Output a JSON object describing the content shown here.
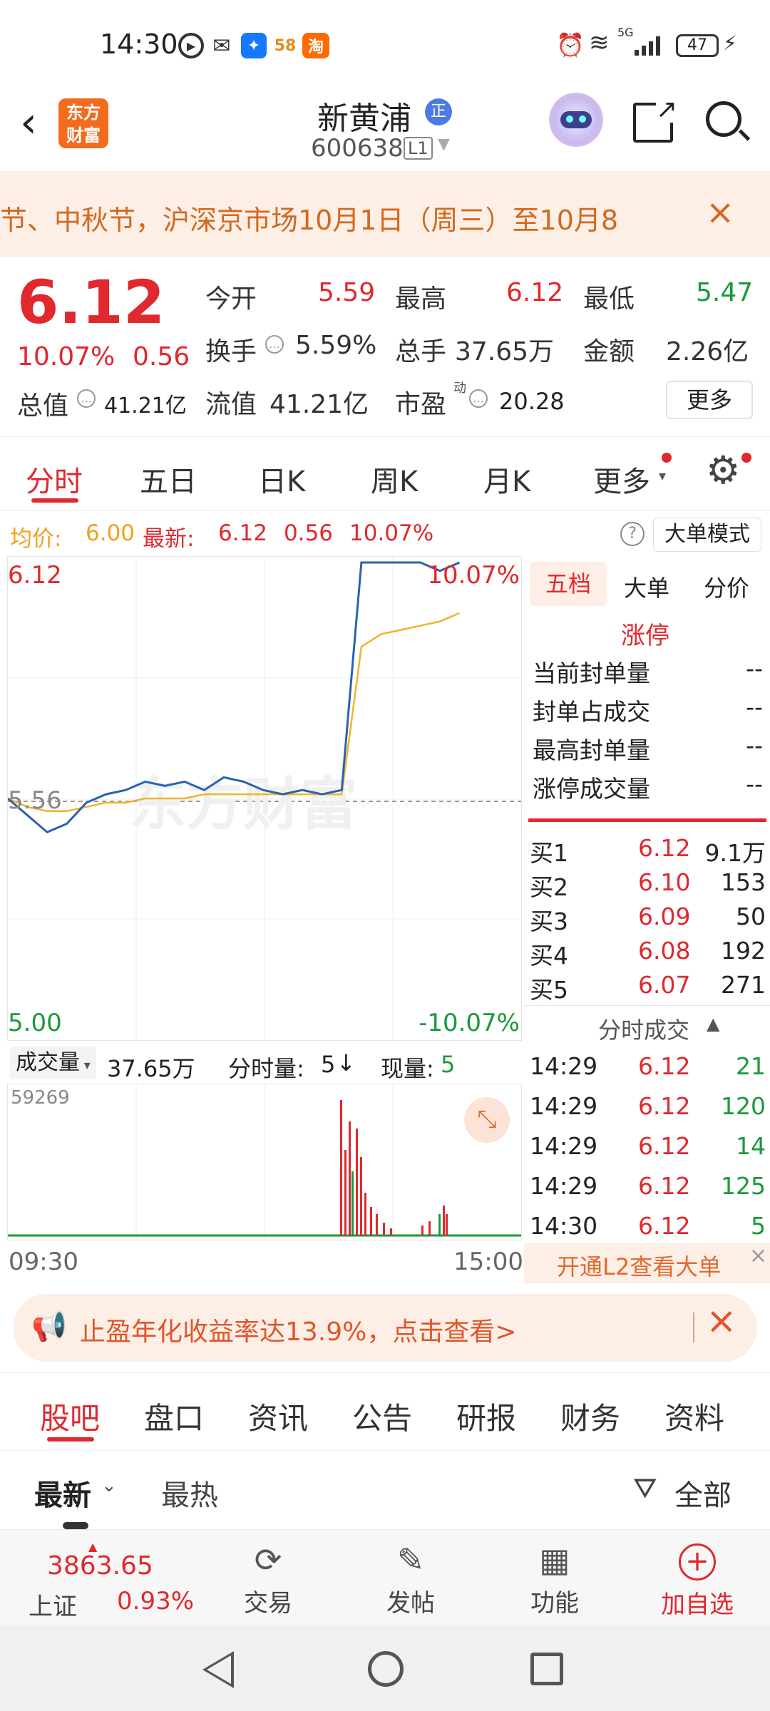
{
  "status_bar": {
    "time": "14:30",
    "battery": "47",
    "app_icons": [
      "58",
      "淘"
    ],
    "signal": "5G"
  },
  "header": {
    "stock_name": "新黄浦",
    "badge": "正",
    "code": "600638",
    "level": "L1",
    "logo_line1": "东方",
    "logo_line2": "财富"
  },
  "notice": {
    "text": "节、中秋节，沪深京市场10月1日（周三）至10月8"
  },
  "quote": {
    "price": "6.12",
    "change_pct": "10.07%",
    "change": "0.56",
    "open_label": "今开",
    "open": "5.59",
    "high_label": "最高",
    "high": "6.12",
    "low_label": "最低",
    "low": "5.47",
    "turnover_label": "换手",
    "turnover": "5.59%",
    "volume_label": "总手",
    "volume": "37.65万",
    "amount_label": "金额",
    "amount": "2.26亿",
    "mktcap_label": "总值",
    "mktcap": "41.21亿",
    "float_label": "流值",
    "float_cap": "41.21亿",
    "pe_label": "市盈",
    "pe_sup": "动",
    "pe": "20.28",
    "more": "更多"
  },
  "tabs": [
    "分时",
    "五日",
    "日K",
    "周K",
    "月K",
    "更多"
  ],
  "avg_line": {
    "avg_label": "均价:",
    "avg": "6.00",
    "latest_label": "最新:",
    "latest": "6.12",
    "chg": "0.56",
    "pct": "10.07%",
    "big_order": "大单模式"
  },
  "chart_labels": {
    "top_price": "6.12",
    "top_pct": "10.07%",
    "mid_price": "5.56",
    "bottom_price": "5.00",
    "bottom_pct": "-10.07%",
    "watermark": "东方财富"
  },
  "volume_bar": {
    "label": "成交量",
    "value": "37.65万",
    "fs_label": "分时量:",
    "fs_value": "5",
    "now_label": "现量:",
    "now_value": "5",
    "max": "59269",
    "t_start": "09:30",
    "t_end": "15:00"
  },
  "right_panel": {
    "tabs": [
      "五档",
      "大单",
      "分价"
    ],
    "limit_up": "涨停",
    "stats": [
      {
        "label": "当前封单量",
        "value": "--"
      },
      {
        "label": "封单占成交",
        "value": "--"
      },
      {
        "label": "最高封单量",
        "value": "--"
      },
      {
        "label": "涨停成交量",
        "value": "--"
      }
    ],
    "bids": [
      {
        "label": "买1",
        "price": "6.12",
        "vol": "9.1万"
      },
      {
        "label": "买2",
        "price": "6.10",
        "vol": "153"
      },
      {
        "label": "买3",
        "price": "6.09",
        "vol": "50"
      },
      {
        "label": "买4",
        "price": "6.08",
        "vol": "192"
      },
      {
        "label": "买5",
        "price": "6.07",
        "vol": "271"
      }
    ],
    "ticks_title": "分时成交",
    "ticks": [
      {
        "t": "14:29",
        "p": "6.12",
        "v": "21"
      },
      {
        "t": "14:29",
        "p": "6.12",
        "v": "120"
      },
      {
        "t": "14:29",
        "p": "6.12",
        "v": "14"
      },
      {
        "t": "14:29",
        "p": "6.12",
        "v": "125"
      },
      {
        "t": "14:30",
        "p": "6.12",
        "v": "5"
      }
    ],
    "l2": "开通L2查看大单"
  },
  "promo": {
    "text": "止盈年化收益率达13.9%，点击查看>"
  },
  "subtabs": [
    "股吧",
    "盘口",
    "资讯",
    "公告",
    "研报",
    "财务",
    "资料"
  ],
  "filter": {
    "latest": "最新",
    "hot": "最热",
    "all": "全部"
  },
  "bottom_bar": {
    "index_value": "3863.65",
    "index_name": "上证",
    "index_pct": "0.93%",
    "trade": "交易",
    "post": "发帖",
    "function": "功能",
    "add": "加自选"
  },
  "colors": {
    "accent": "#e0282e",
    "up": "#e0282e",
    "down": "#1a9a3a",
    "price_line": "#2a62b0",
    "avg_line": "#f0b429"
  },
  "chart_data": {
    "type": "line",
    "title": "",
    "x": [
      "09:30",
      "15:00"
    ],
    "ylim": [
      5.0,
      6.12
    ],
    "series": [
      {
        "name": "最新",
        "values": [
          5.56,
          5.52,
          5.48,
          5.5,
          5.55,
          5.57,
          5.58,
          5.6,
          5.59,
          5.6,
          5.58,
          5.61,
          5.6,
          5.58,
          5.57,
          5.58,
          5.57,
          5.58,
          6.12,
          6.12,
          6.12,
          6.12,
          6.1,
          6.12
        ]
      },
      {
        "name": "均价",
        "values": [
          5.56,
          5.54,
          5.53,
          5.53,
          5.54,
          5.55,
          5.55,
          5.56,
          5.56,
          5.56,
          5.57,
          5.57,
          5.57,
          5.57,
          5.57,
          5.57,
          5.57,
          5.57,
          5.92,
          5.95,
          5.96,
          5.97,
          5.98,
          6.0
        ]
      }
    ]
  }
}
